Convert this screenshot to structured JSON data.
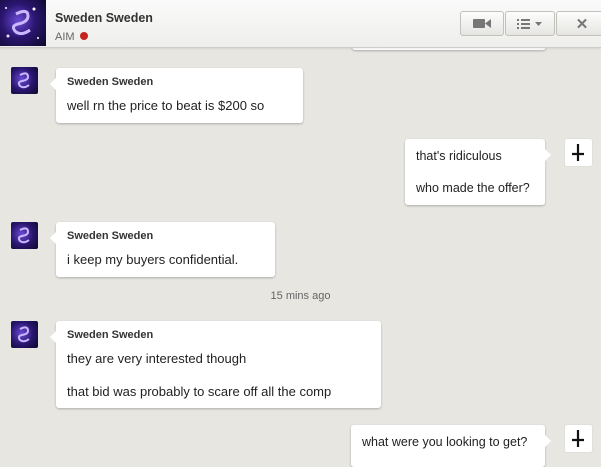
{
  "header": {
    "contact_name": "Sweden Sweden",
    "service": "AIM",
    "status_color": "#c4261d",
    "buttons": [
      "video-icon",
      "menu-list-icon",
      "close-icon"
    ],
    "close_glyph": "✕"
  },
  "messages": [
    {
      "direction": "in",
      "sender": "Sweden Sweden",
      "lines": [
        "well rn the price to beat is $200 so"
      ]
    },
    {
      "direction": "out",
      "lines": [
        "that's ridiculous",
        "who made the offer?"
      ]
    },
    {
      "direction": "in",
      "sender": "Sweden Sweden",
      "lines": [
        "i keep my buyers confidential."
      ]
    },
    {
      "direction": "in",
      "sender": "Sweden Sweden",
      "lines": [
        "they are very interested though",
        "that bid was probably to scare off all the comp"
      ]
    },
    {
      "direction": "out",
      "lines": [
        "what were you looking to get?"
      ]
    }
  ],
  "timestamp": "15 mins ago"
}
